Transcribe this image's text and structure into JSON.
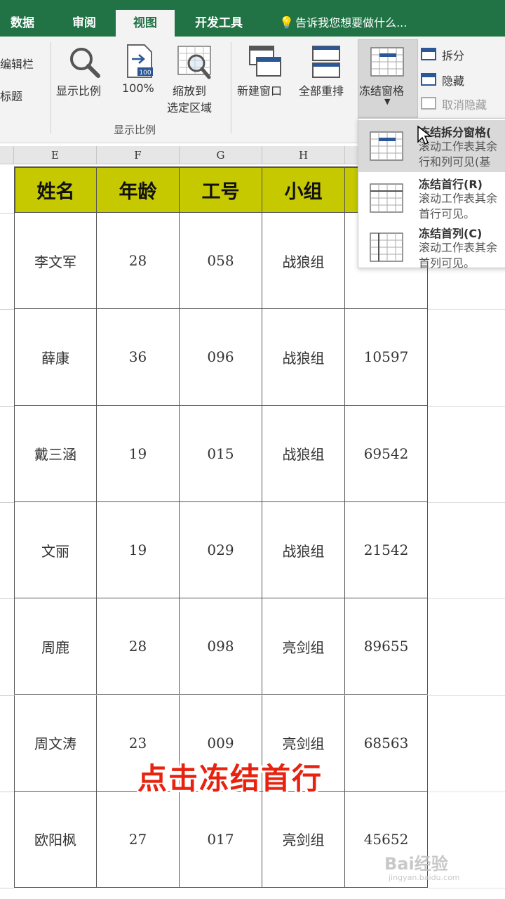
{
  "tabs": {
    "data": "数据",
    "review": "审阅",
    "view": "视图",
    "developer": "开发工具",
    "tell_me": "告诉我您想要做什么..."
  },
  "ribbon": {
    "left_partial": {
      "formula_bar": "编辑栏",
      "headings": "标题"
    },
    "zoom": "显示比例",
    "zoom_100": "100%",
    "zoom_to_selection": "缩放到\n选定区域",
    "zoom_to_selection_l1": "缩放到",
    "zoom_to_selection_l2": "选定区域",
    "zoom_group_label": "显示比例",
    "new_window": "新建窗口",
    "arrange_all": "全部重排",
    "freeze_panes": "冻结窗格",
    "split": "拆分",
    "hide": "隐藏",
    "unhide": "取消隐藏"
  },
  "freeze_menu": [
    {
      "title": "冻结拆分窗格(",
      "desc1": "滚动工作表其余",
      "desc2": "行和列可见(基"
    },
    {
      "title": "冻结首行(R)",
      "desc1": "滚动工作表其余",
      "desc2": "首行可见。"
    },
    {
      "title": "冻结首列(C)",
      "desc1": "滚动工作表其余",
      "desc2": "首列可见。"
    }
  ],
  "columns": [
    "E",
    "F",
    "G",
    "H",
    ""
  ],
  "table": {
    "headers": [
      "姓名",
      "年龄",
      "工号",
      "小组",
      ""
    ],
    "rows": [
      [
        "李文军",
        "28",
        "058",
        "战狼组",
        ""
      ],
      [
        "薛康",
        "36",
        "096",
        "战狼组",
        "10597"
      ],
      [
        "戴三涵",
        "19",
        "015",
        "战狼组",
        "69542"
      ],
      [
        "文丽",
        "19",
        "029",
        "战狼组",
        "21542"
      ],
      [
        "周鹿",
        "28",
        "098",
        "亮剑组",
        "89655"
      ],
      [
        "周文涛",
        "23",
        "009",
        "亮剑组",
        "68563"
      ],
      [
        "欧阳枫",
        "27",
        "017",
        "亮剑组",
        "45652"
      ]
    ]
  },
  "caption": "点击冻结首行",
  "watermark": {
    "brand": "Bai经验",
    "url": "jingyan.baidu.com"
  }
}
